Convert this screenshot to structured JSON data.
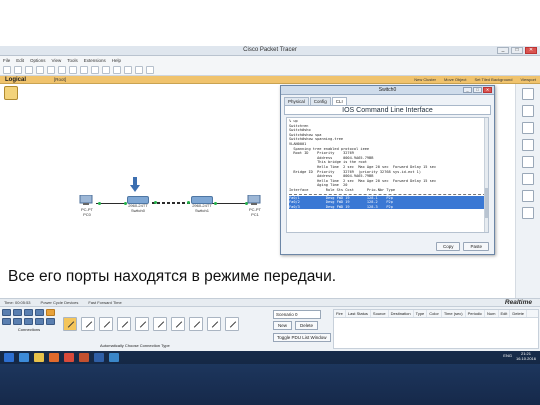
{
  "window": {
    "title": "Cisco Packet Tracer",
    "controls": [
      "_",
      "□",
      "✕"
    ]
  },
  "menubar": [
    "File",
    "Edit",
    "Options",
    "View",
    "Tools",
    "Extensions",
    "Help"
  ],
  "modebar": {
    "logical": "Logical",
    "root": "[Root]",
    "right_items": [
      "New Cluster",
      "Move Object",
      "Set Tiled Background",
      "Viewport"
    ]
  },
  "devices": {
    "pc0": {
      "model": "PC-PT",
      "name": "PC0"
    },
    "pc1": {
      "model": "PC-PT",
      "name": "PC1"
    },
    "switch0": {
      "model": "2960-24TT",
      "name": "Switch0"
    },
    "switch1": {
      "model": "2960-24TT",
      "name": "Switch1"
    }
  },
  "dialog": {
    "title": "Switch0",
    "controls": [
      "_",
      "□",
      "✕"
    ],
    "tabs": [
      "Physical",
      "Config",
      "CLI"
    ],
    "active_tab": "CLI",
    "cli_header": "IOS Command Line Interface",
    "lines": [
      "% up",
      "",
      "Switch>en",
      "Switch#sho",
      "Switch#show spa",
      "Switch#show spanning-tree",
      "VLAN0001",
      "  Spanning tree enabled protocol ieee",
      "  Root ID    Priority    32769",
      "             Address     0004.9A65.79BB",
      "             This bridge is the root",
      "             Hello Time  2 sec  Max Age 20 sec  Forward Delay 15 sec",
      "",
      "  Bridge ID  Priority    32769  (priority 32768 sys-id-ext 1)",
      "             Address     0004.9A65.79BB",
      "             Hello Time  2 sec  Max Age 20 sec  Forward Delay 15 sec",
      "             Aging Time  20",
      "",
      "Interface        Role Sts Cost      Prio.Nbr Type"
    ],
    "rows": [
      "Fa0/1            Desg FWD 19        128.1    P2p",
      "Fa0/2            Desg FWD 19        128.2    P2p",
      "Fa0/3            Desg FWD 19        128.3    P2p"
    ],
    "buttons": [
      "Copy",
      "Paste"
    ]
  },
  "caption": "Все его порты находятся в режиме передачи.",
  "statusbar": {
    "time": "Time: 00:05:53",
    "power": "Power Cycle Devices",
    "fast_forward": "Fast Forward Time",
    "mode": "Realtime"
  },
  "bottom": {
    "device_category_label": "Connections",
    "cable_label": "Automatically Choose Connection Type",
    "scenario": "Scenario 0",
    "new_label": "New",
    "delete_label": "Delete",
    "toggle_label": "Toggle PDU List Window",
    "pdu_columns": [
      "Fire",
      "Last Status",
      "Source",
      "Destination",
      "Type",
      "Color",
      "Time (sec)",
      "Periodic",
      "Num",
      "Edit",
      "Delete"
    ]
  },
  "taskbar": {
    "lang": "ENG",
    "clock_time": "21:21",
    "clock_date": "16.10.2016"
  },
  "colors": {
    "accent_mode_bar": "#f0c36d",
    "cli_highlight": "#3a78d4",
    "link_green": "#24b24a"
  }
}
